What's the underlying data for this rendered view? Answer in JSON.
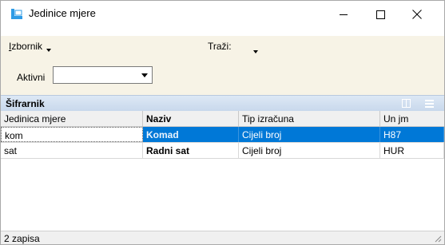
{
  "window": {
    "title": "Jedinice mjere",
    "icon": "app-window-icon",
    "controls": [
      "minimize-icon",
      "maximize-icon",
      "close-icon"
    ]
  },
  "menu": {
    "izbornik_first": "I",
    "izbornik_rest": "zbornik",
    "trazi": "Traži:"
  },
  "filter": {
    "label": "Aktivni",
    "value": ""
  },
  "grid": {
    "caption": "Šifrarnik",
    "columns": [
      "Jedinica mjere",
      "Naziv",
      "Tip izračuna",
      "Un jm"
    ],
    "rows": [
      {
        "jedinica": "kom",
        "naziv": "Komad",
        "tip": "Cijeli broj",
        "unjm": "H87",
        "selected": true
      },
      {
        "jedinica": "sat",
        "naziv": "Radni sat",
        "tip": "Cijeli broj",
        "unjm": "HUR",
        "selected": false
      }
    ]
  },
  "status": {
    "text": "2 zapisa"
  },
  "colors": {
    "accent": "#0078d7",
    "panel": "#f7f3e6",
    "caption": "#c8d8ec"
  }
}
